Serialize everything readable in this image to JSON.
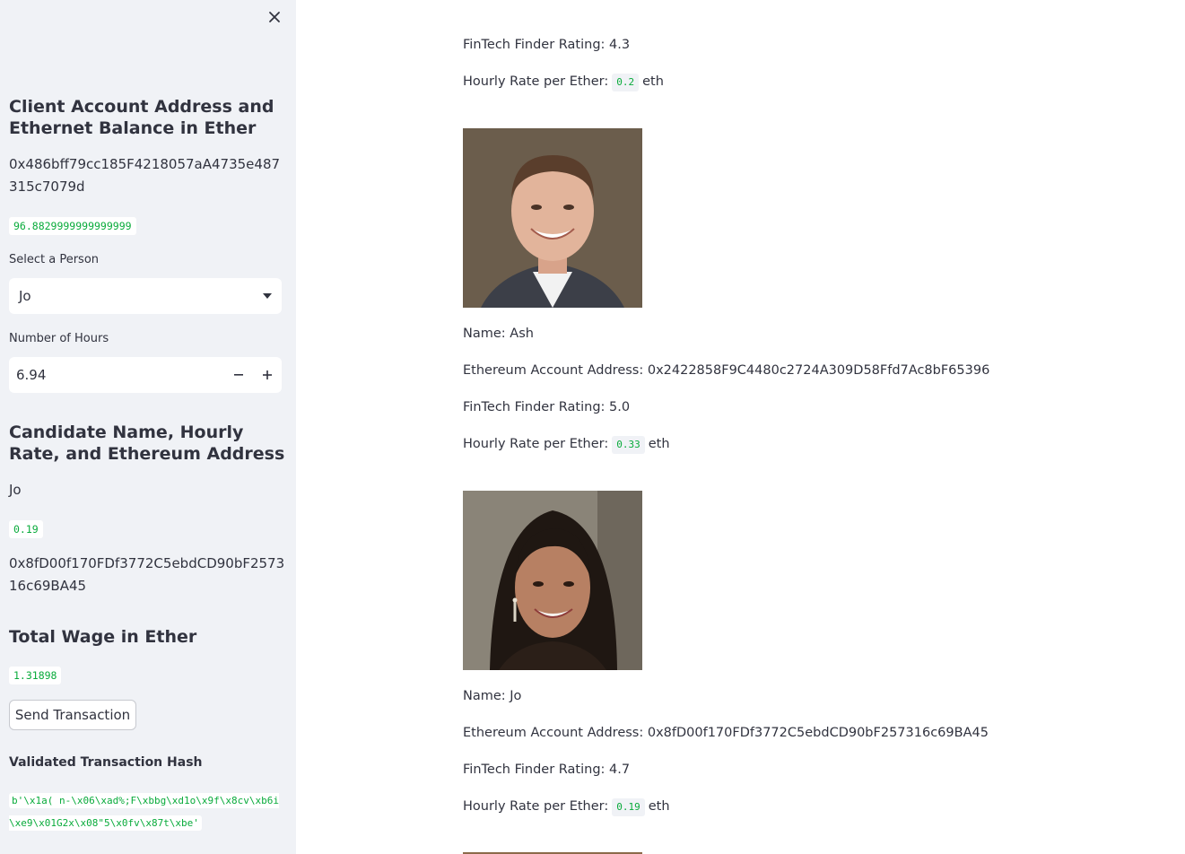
{
  "sidebar": {
    "close_icon": "close-icon",
    "client_heading": "Client Account Address and Ethernet Balance in Ether",
    "client_address": "0x486bff79cc185F4218057aA4735e487315c7079d",
    "client_balance": "96.8829999999999999",
    "select_person_label": "Select a Person",
    "selected_person": "Jo",
    "hours_label": "Number of Hours",
    "hours_value": "6.94",
    "candidate_heading": "Candidate Name, Hourly Rate, and Ethereum Address",
    "candidate_name": "Jo",
    "candidate_rate": "0.19",
    "candidate_address": "0x8fD00f170FDf3772C5ebdCD90bF257316c69BA45",
    "wage_heading": "Total Wage in Ether",
    "wage_value": "1.31898",
    "send_button": "Send Transaction",
    "hash_heading": "Validated Transaction Hash",
    "hash_value": "b'\\x1a( n-\\x06\\xad%;F\\xbbg\\xd1o\\x9f\\x8cv\\xb6i\\xe9\\x01G2x\\x08\"5\\x0fv\\x87t\\xbe'"
  },
  "main": {
    "top": {
      "rating": "FinTech Finder Rating: 4.3",
      "rate_prefix": "Hourly Rate per Ether:",
      "rate": "0.2",
      "rate_unit": "eth"
    },
    "candidates": [
      {
        "name": "Name: Ash",
        "address": "Ethereum Account Address: 0x2422858F9C4480c2724A309D58Ffd7Ac8bF65396",
        "rating": "FinTech Finder Rating: 5.0",
        "rate_prefix": "Hourly Rate per Ether:",
        "rate": "0.33",
        "rate_unit": "eth"
      },
      {
        "name": "Name: Jo",
        "address": "Ethereum Account Address: 0x8fD00f170FDf3772C5ebdCD90bF257316c69BA45",
        "rating": "FinTech Finder Rating: 4.7",
        "rate_prefix": "Hourly Rate per Ether:",
        "rate": "0.19",
        "rate_unit": "eth"
      }
    ]
  },
  "colors": {
    "sidebar_bg": "#f0f2f6",
    "code_green": "#09ab3b",
    "text": "#31333f"
  }
}
